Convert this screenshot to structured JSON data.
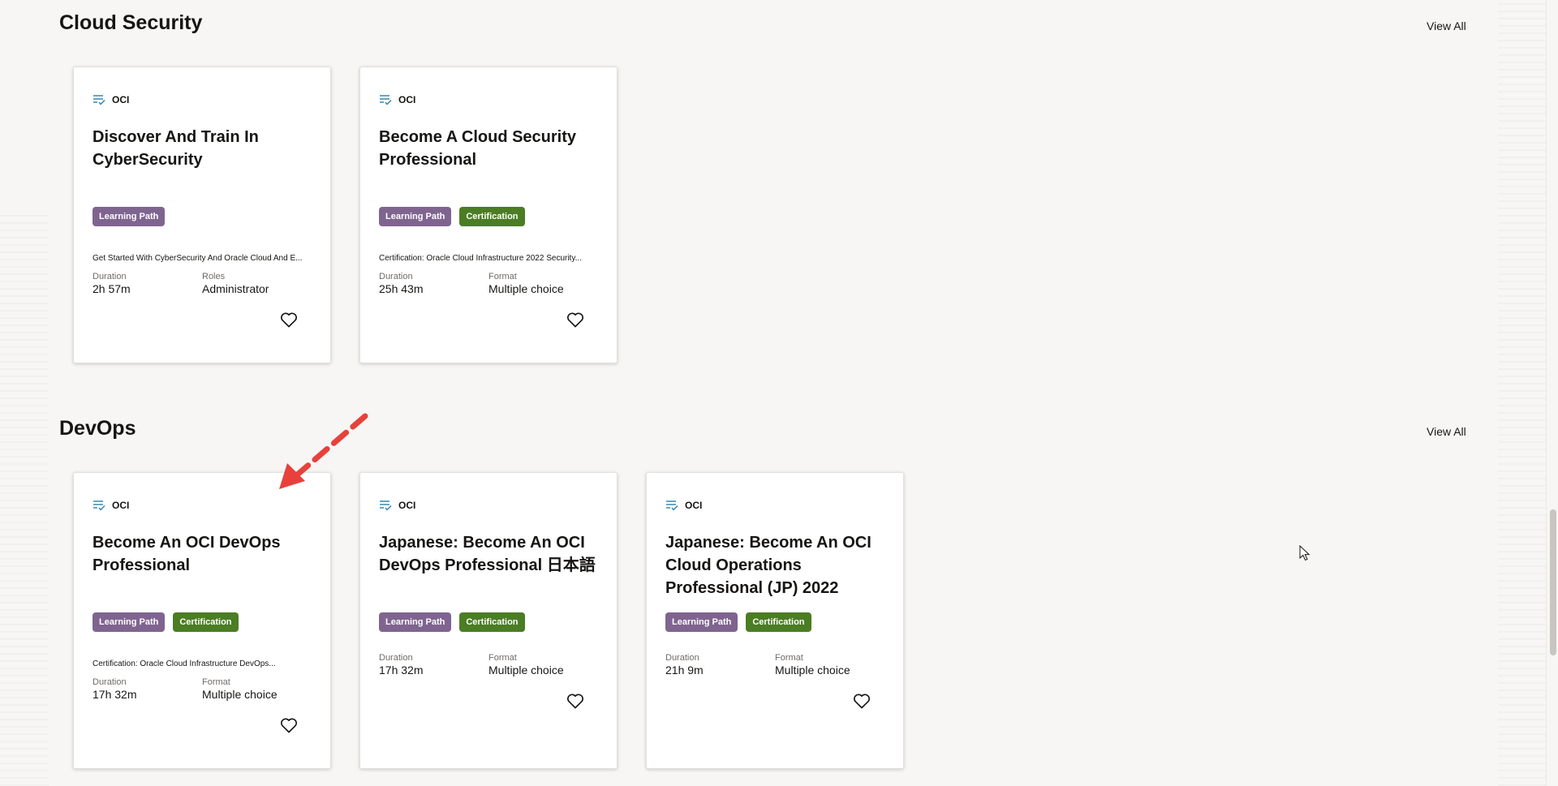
{
  "sections": [
    {
      "title": "Cloud Security",
      "view_all": "View All",
      "cards": [
        {
          "tag": "OCI",
          "title": "Discover And Train In CyberSecurity",
          "badges": [
            "Learning Path"
          ],
          "description": "Get Started With CyberSecurity And Oracle Cloud And E...",
          "meta": [
            {
              "label": "Duration",
              "value": "2h 57m"
            },
            {
              "label": "Roles",
              "value": "Administrator"
            }
          ]
        },
        {
          "tag": "OCI",
          "title": "Become A Cloud Security Professional",
          "badges": [
            "Learning Path",
            "Certification"
          ],
          "description": "Certification: Oracle Cloud Infrastructure 2022 Security...",
          "meta": [
            {
              "label": "Duration",
              "value": "25h 43m"
            },
            {
              "label": "Format",
              "value": "Multiple choice"
            }
          ]
        }
      ]
    },
    {
      "title": "DevOps",
      "view_all": "View All",
      "cards": [
        {
          "tag": "OCI",
          "title": "Become An OCI DevOps Professional",
          "badges": [
            "Learning Path",
            "Certification"
          ],
          "description": "Certification: Oracle Cloud Infrastructure DevOps...",
          "meta": [
            {
              "label": "Duration",
              "value": "17h 32m"
            },
            {
              "label": "Format",
              "value": "Multiple choice"
            }
          ]
        },
        {
          "tag": "OCI",
          "title": "Japanese: Become An OCI DevOps Professional 日本語",
          "badges": [
            "Learning Path",
            "Certification"
          ],
          "description": "",
          "meta": [
            {
              "label": "Duration",
              "value": "17h 32m"
            },
            {
              "label": "Format",
              "value": "Multiple choice"
            }
          ]
        },
        {
          "tag": "OCI",
          "title": "Japanese: Become An OCI Cloud Operations Professional (JP) 2022",
          "badges": [
            "Learning Path",
            "Certification"
          ],
          "description": "",
          "meta": [
            {
              "label": "Duration",
              "value": "21h 9m"
            },
            {
              "label": "Format",
              "value": "Multiple choice"
            }
          ]
        }
      ]
    }
  ],
  "icons": {
    "tag_icon": "checklist-icon",
    "favorite_icon": "heart-outline-icon",
    "annotation": "red-dashed-arrow-icon",
    "pointer": "mouse-cursor-icon"
  },
  "colors": {
    "badge_learning_path": "#7f6490",
    "badge_certification": "#4b7d24",
    "tag_icon": "#2a7fa8",
    "annotation_arrow": "#e8413c"
  }
}
